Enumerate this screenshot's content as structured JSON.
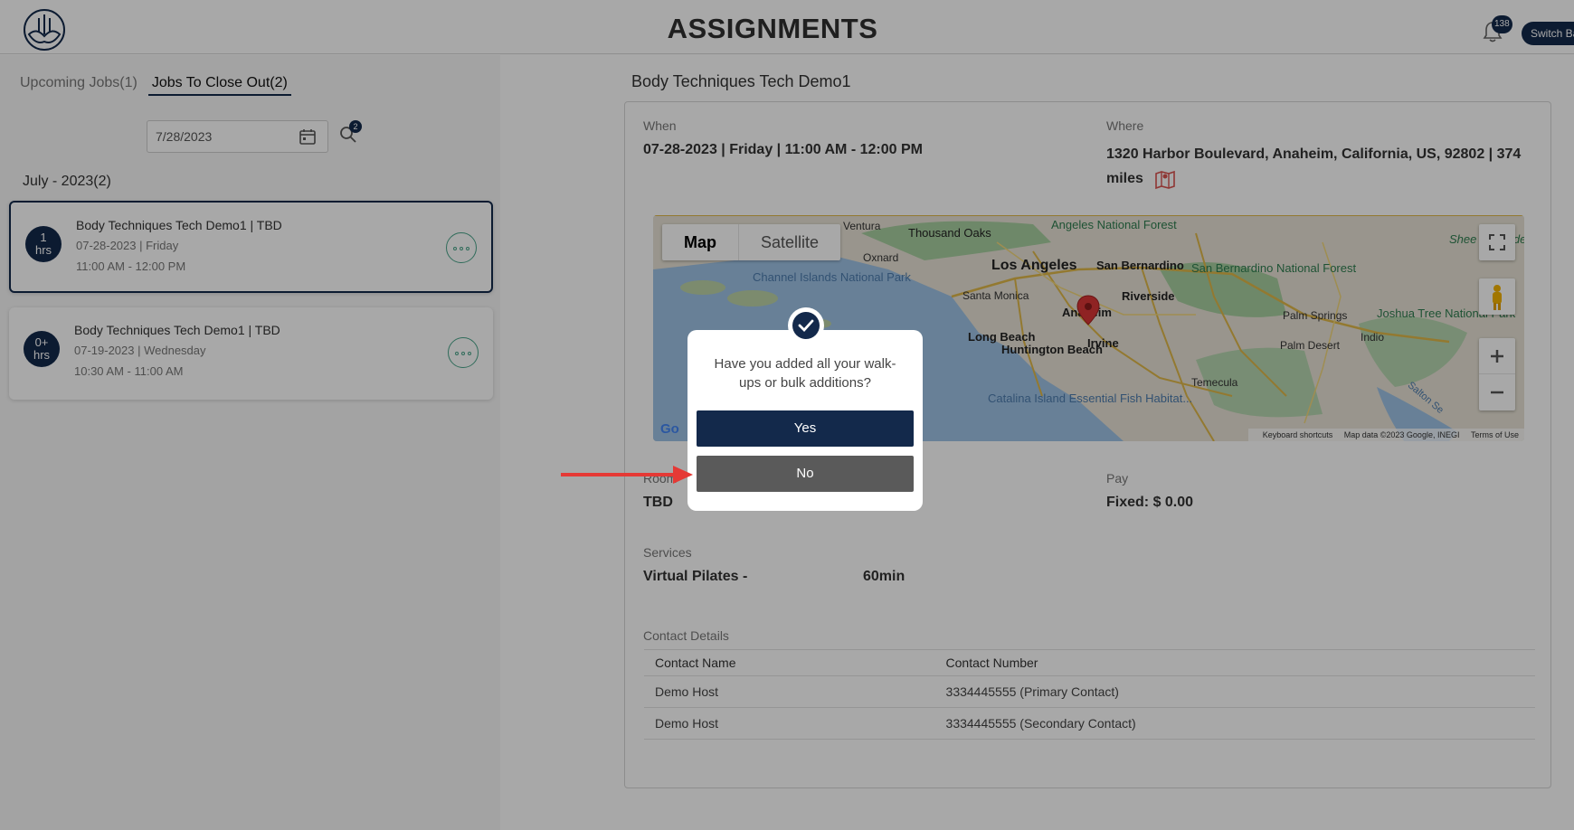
{
  "header": {
    "title": "ASSIGNMENTS",
    "notification_count": "138",
    "switch_label": "Switch Ba"
  },
  "left": {
    "tabs": [
      {
        "label": "Upcoming Jobs(1)"
      },
      {
        "label": "Jobs To Close Out(2)"
      }
    ],
    "date_value": "7/28/2023",
    "search_badge": "2",
    "month_label": "July - 2023(2)",
    "jobs": [
      {
        "hours_top": "1",
        "hours_bottom": "hrs",
        "title": "Body Techniques Tech Demo1 | TBD",
        "date": "07-28-2023 | Friday",
        "time": "11:00 AM - 12:00 PM"
      },
      {
        "hours_top": "0+",
        "hours_bottom": "hrs",
        "title": "Body Techniques Tech Demo1 | TBD",
        "date": "07-19-2023 | Wednesday",
        "time": "10:30 AM - 11:00 AM"
      }
    ]
  },
  "detail": {
    "title": "Body Techniques Tech Demo1",
    "when_label": "When",
    "when_value": "07-28-2023 | Friday | 11:00 AM - 12:00 PM",
    "where_label": "Where",
    "where_line1": "1320 Harbor Boulevard, Anaheim, California, US, 92802 | 374",
    "where_line2": "miles",
    "room_label": "Room",
    "room_value": "TBD",
    "pay_label": "Pay",
    "pay_value": "Fixed: $ 0.00",
    "services_label": "Services",
    "service_name": "Virtual Pilates -",
    "service_duration": "60min",
    "contacts_label": "Contact Details",
    "contacts_headers": [
      "Contact Name",
      "Contact Number"
    ],
    "contacts": [
      {
        "name": "Demo Host",
        "number": "3334445555 (Primary Contact)"
      },
      {
        "name": "Demo Host",
        "number": "3334445555 (Secondary Contact)"
      }
    ]
  },
  "map": {
    "type_map": "Map",
    "type_satellite": "Satellite",
    "labels": {
      "ventura": "Ventura",
      "thousand_oaks": "Thousand Oaks",
      "oxnard": "Oxnard",
      "angeles_nf": "Angeles National Forest",
      "los_angeles": "Los Angeles",
      "san_bernardino": "San Bernardino",
      "sb_nf": "San Bernardino National Forest",
      "santa_monica": "Santa Monica",
      "riverside": "Riverside",
      "anaheim": "Anaheim",
      "long_beach": "Long Beach",
      "huntington_beach": "Huntington Beach",
      "irvine": "Irvine",
      "channel_islands": "Channel Islands National Park",
      "catalina": "Catalina Island Essential Fish Habitat...",
      "temecula": "Temecula",
      "palm_springs": "Palm Springs",
      "palm_desert": "Palm Desert",
      "indio": "Indio",
      "joshua_tree": "Joshua Tree National Park",
      "sheep_mtn": "Shee Va Wilderness",
      "salton": "Salton Se"
    },
    "footer": [
      "Keyboard shortcuts",
      "Map data ©2023 Google, INEGI",
      "Terms of Use"
    ],
    "google": "Go"
  },
  "modal": {
    "question": "Have you added all your walk-ups or bulk additions?",
    "yes_label": "Yes",
    "no_label": "No"
  },
  "colors": {
    "brand_navy": "#13294b",
    "no_button": "#5a5a5a",
    "accent_green": "#4aa58a",
    "annotation_red": "#e53935"
  }
}
